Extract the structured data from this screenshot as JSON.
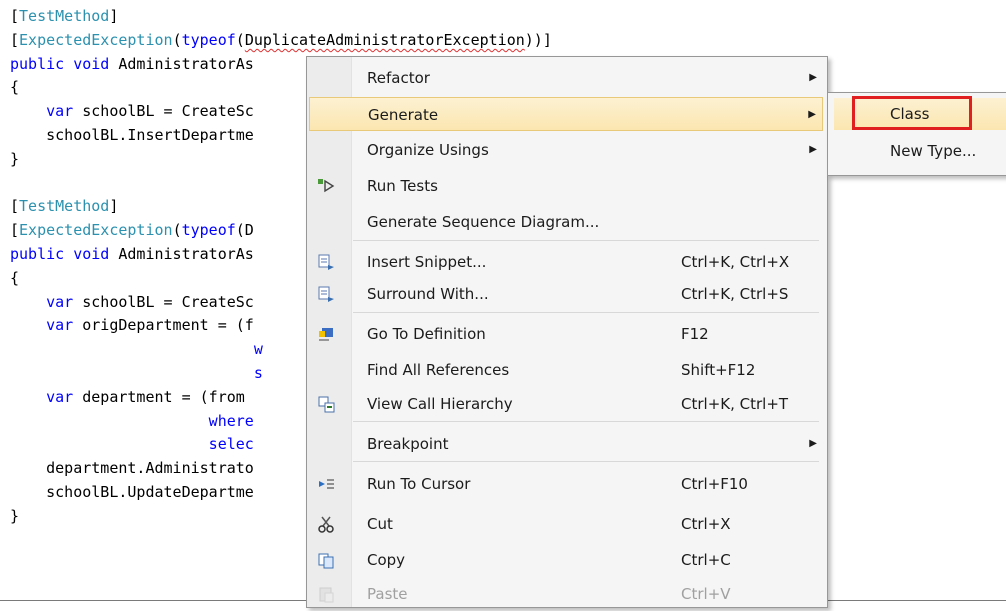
{
  "editor": {
    "lines": [
      [
        {
          "t": "[",
          "c": ""
        },
        {
          "t": "TestMethod",
          "c": "attr"
        },
        {
          "t": "]",
          "c": ""
        }
      ],
      [
        {
          "t": "[",
          "c": ""
        },
        {
          "t": "ExpectedException",
          "c": "attr"
        },
        {
          "t": "(",
          "c": ""
        },
        {
          "t": "typeof",
          "c": "kw"
        },
        {
          "t": "(",
          "c": ""
        },
        {
          "t": "DuplicateAdministratorException",
          "c": "squig"
        },
        {
          "t": "))]",
          "c": ""
        }
      ],
      [
        {
          "t": "public void ",
          "c": "kw"
        },
        {
          "t": "AdministratorAs",
          "c": ""
        }
      ],
      [
        {
          "t": "{",
          "c": ""
        }
      ],
      [
        {
          "t": "    ",
          "c": ""
        },
        {
          "t": "var",
          "c": "kw"
        },
        {
          "t": " schoolBL = CreateSc",
          "c": ""
        }
      ],
      [
        {
          "t": "    schoolBL.InsertDepartme",
          "c": ""
        }
      ],
      [
        {
          "t": "}",
          "c": ""
        }
      ],
      [
        {
          "t": "",
          "c": ""
        }
      ],
      [
        {
          "t": "[",
          "c": ""
        },
        {
          "t": "TestMethod",
          "c": "attr"
        },
        {
          "t": "]",
          "c": ""
        }
      ],
      [
        {
          "t": "[",
          "c": ""
        },
        {
          "t": "ExpectedException",
          "c": "attr"
        },
        {
          "t": "(",
          "c": ""
        },
        {
          "t": "typeof",
          "c": "kw"
        },
        {
          "t": "(D",
          "c": ""
        }
      ],
      [
        {
          "t": "public void ",
          "c": "kw"
        },
        {
          "t": "AdministratorAs",
          "c": ""
        }
      ],
      [
        {
          "t": "{",
          "c": ""
        }
      ],
      [
        {
          "t": "    ",
          "c": ""
        },
        {
          "t": "var",
          "c": "kw"
        },
        {
          "t": " schoolBL = CreateSc",
          "c": ""
        }
      ],
      [
        {
          "t": "    ",
          "c": ""
        },
        {
          "t": "var",
          "c": "kw"
        },
        {
          "t": " origDepartment = (f",
          "c": ""
        }
      ],
      [
        {
          "t": "                           w",
          "c": "kw"
        }
      ],
      [
        {
          "t": "                           s",
          "c": "kw"
        }
      ],
      [
        {
          "t": "    ",
          "c": ""
        },
        {
          "t": "var",
          "c": "kw"
        },
        {
          "t": " department = (from",
          "c": ""
        }
      ],
      [
        {
          "t": "                      where",
          "c": "kw"
        }
      ],
      [
        {
          "t": "                      selec",
          "c": "kw"
        }
      ],
      [
        {
          "t": "    department.Administrato",
          "c": ""
        }
      ],
      [
        {
          "t": "    schoolBL.UpdateDepartme",
          "c": ""
        }
      ],
      [
        {
          "t": "}",
          "c": ""
        }
      ]
    ]
  },
  "context_menu": {
    "items": [
      {
        "label": "Refactor",
        "shortcut": "",
        "submenu": true,
        "icon": "",
        "highlight": false,
        "disabled": false
      },
      {
        "label": "Generate",
        "shortcut": "",
        "submenu": true,
        "icon": "",
        "highlight": true,
        "disabled": false
      },
      {
        "label": "Organize Usings",
        "shortcut": "",
        "submenu": true,
        "icon": "",
        "highlight": false,
        "disabled": false
      },
      {
        "label": "Run Tests",
        "shortcut": "",
        "submenu": false,
        "icon": "run-tests-icon",
        "highlight": false,
        "disabled": false
      },
      {
        "label": "Generate Sequence Diagram...",
        "shortcut": "",
        "submenu": false,
        "icon": "",
        "highlight": false,
        "disabled": false
      },
      {
        "sep": true
      },
      {
        "label": "Insert Snippet...",
        "shortcut": "Ctrl+K, Ctrl+X",
        "submenu": false,
        "icon": "snippet-icon",
        "highlight": false,
        "disabled": false
      },
      {
        "label": "Surround With...",
        "shortcut": "Ctrl+K, Ctrl+S",
        "submenu": false,
        "icon": "surround-icon",
        "highlight": false,
        "disabled": false
      },
      {
        "sep": true
      },
      {
        "label": "Go To Definition",
        "shortcut": "F12",
        "submenu": false,
        "icon": "go-to-definition-icon",
        "highlight": false,
        "disabled": false
      },
      {
        "label": "Find All References",
        "shortcut": "Shift+F12",
        "submenu": false,
        "icon": "",
        "highlight": false,
        "disabled": false
      },
      {
        "label": "View Call Hierarchy",
        "shortcut": "Ctrl+K, Ctrl+T",
        "submenu": false,
        "icon": "call-hierarchy-icon",
        "highlight": false,
        "disabled": false
      },
      {
        "sep": true
      },
      {
        "label": "Breakpoint",
        "shortcut": "",
        "submenu": true,
        "icon": "",
        "highlight": false,
        "disabled": false
      },
      {
        "sep": true
      },
      {
        "label": "Run To Cursor",
        "shortcut": "Ctrl+F10",
        "submenu": false,
        "icon": "run-to-cursor-icon",
        "highlight": false,
        "disabled": false
      },
      {
        "label": "Cut",
        "shortcut": "Ctrl+X",
        "submenu": false,
        "icon": "cut-icon",
        "highlight": false,
        "disabled": false
      },
      {
        "label": "Copy",
        "shortcut": "Ctrl+C",
        "submenu": false,
        "icon": "copy-icon",
        "highlight": false,
        "disabled": false
      },
      {
        "label": "Paste",
        "shortcut": "Ctrl+V",
        "submenu": false,
        "icon": "paste-icon",
        "highlight": false,
        "disabled": true
      }
    ]
  },
  "submenu": {
    "items": [
      {
        "label": "Class",
        "highlight": true
      },
      {
        "label": "New Type...",
        "highlight": false
      }
    ]
  },
  "colors": {
    "highlight_border": "#e02020",
    "attribute": "#2b91af",
    "keyword": "#0000ff"
  }
}
